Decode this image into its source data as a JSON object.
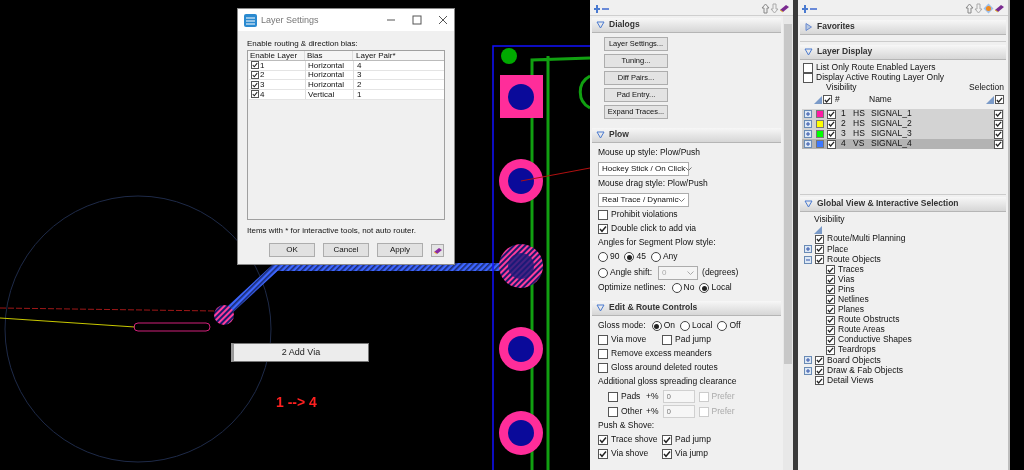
{
  "canvas": {
    "tooltip": "2 Add Via",
    "annotation": "1 --> 4"
  },
  "layer_settings_dialog": {
    "title": "Layer Settings",
    "prompt": "Enable routing & direction bias:",
    "columns": [
      "Enable Layer",
      "Bias",
      "Layer Pair*"
    ],
    "rows": [
      {
        "enabled": true,
        "layer": "1",
        "bias": "Horizontal",
        "pair": "4"
      },
      {
        "enabled": true,
        "layer": "2",
        "bias": "Horizontal",
        "pair": "3"
      },
      {
        "enabled": true,
        "layer": "3",
        "bias": "Horizontal",
        "pair": "2"
      },
      {
        "enabled": true,
        "layer": "4",
        "bias": "Vertical",
        "pair": "1"
      }
    ],
    "note": "Items with * for interactive tools, not auto router.",
    "buttons": [
      "OK",
      "Cancel",
      "Apply"
    ]
  },
  "options_panel": {
    "sections": [
      {
        "title": "Dialogs",
        "expanded": true,
        "items": [
          {
            "kind": "button",
            "label": "Layer Settings..."
          },
          {
            "kind": "button",
            "label": "Tuning..."
          },
          {
            "kind": "button",
            "label": "Diff Pairs..."
          },
          {
            "kind": "button",
            "label": "Pad Entry..."
          },
          {
            "kind": "button",
            "label": "Expand Traces..."
          }
        ]
      },
      {
        "title": "Plow",
        "expanded": true,
        "items": [
          {
            "kind": "label",
            "text": "Mouse up style: Plow/Push"
          },
          {
            "kind": "select",
            "value": "Hockey Stick / On Click"
          },
          {
            "kind": "label",
            "text": "Mouse drag style: Plow/Push"
          },
          {
            "kind": "select",
            "value": "Real Trace / Dynamic"
          },
          {
            "kind": "checks",
            "items": [
              {
                "label": "Prohibit violations",
                "checked": false
              }
            ]
          },
          {
            "kind": "checks",
            "items": [
              {
                "label": "Double click to add via",
                "checked": true
              }
            ]
          },
          {
            "kind": "label",
            "text": "Angles for Segment Plow style:"
          },
          {
            "kind": "radios",
            "options": [
              {
                "label": "90",
                "selected": false
              },
              {
                "label": "45",
                "selected": true
              },
              {
                "label": "Any",
                "selected": false
              }
            ]
          },
          {
            "kind": "angle_shift",
            "label": "Angle shift:",
            "selected": false,
            "value": "0",
            "disabled": true,
            "suffix": "(degrees)"
          },
          {
            "kind": "radios",
            "label": "Optimize netlines:",
            "options": [
              {
                "label": "No",
                "selected": false
              },
              {
                "label": "Local",
                "selected": true
              }
            ]
          }
        ]
      },
      {
        "title": "Edit & Route Controls",
        "expanded": true,
        "items": [
          {
            "kind": "radios",
            "label": "Gloss mode:",
            "options": [
              {
                "label": "On",
                "selected": true
              },
              {
                "label": "Local",
                "selected": false
              },
              {
                "label": "Off",
                "selected": false
              }
            ]
          },
          {
            "kind": "checks",
            "items": [
              {
                "label": "Via move",
                "checked": false
              },
              {
                "label": "Pad jump",
                "checked": false
              }
            ]
          },
          {
            "kind": "checks",
            "items": [
              {
                "label": "Remove excess meanders",
                "checked": false
              }
            ]
          },
          {
            "kind": "checks",
            "items": [
              {
                "label": "Gloss around deleted routes",
                "checked": false
              }
            ]
          },
          {
            "kind": "label",
            "text": "Additional gloss spreading clearance"
          },
          {
            "kind": "clearance",
            "label": "Pads",
            "checked": false,
            "unit": "+%",
            "value": "0",
            "disabled": true,
            "prefer": "Prefer",
            "prefer_checked": false
          },
          {
            "kind": "clearance",
            "label": "Other",
            "checked": false,
            "unit": "+%",
            "value": "0",
            "disabled": true,
            "prefer": "Prefer",
            "prefer_checked": false
          },
          {
            "kind": "label",
            "text": "Push & Shove:"
          },
          {
            "kind": "checks",
            "items": [
              {
                "label": "Trace shove",
                "checked": true
              },
              {
                "label": "Pad jump",
                "checked": true
              }
            ]
          },
          {
            "kind": "checks",
            "items": [
              {
                "label": "Via shove",
                "checked": true
              },
              {
                "label": "Via jump",
                "checked": true
              }
            ]
          }
        ]
      }
    ]
  },
  "display_panel": {
    "favorites": {
      "title": "Favorites",
      "expanded": false
    },
    "layer_display": {
      "title": "Layer Display",
      "expanded": true,
      "options": [
        {
          "label": "List Only Route Enabled Layers",
          "checked": false
        },
        {
          "label": "Display Active Routing Layer Only",
          "checked": false
        }
      ],
      "visibility_label": "Visibility",
      "selection_label": "Selection",
      "all_visible": true,
      "all_selectable": true,
      "columns": [
        "#",
        "Name"
      ],
      "layers": [
        {
          "number": "1",
          "type": "HS",
          "name": "SIGNAL_1",
          "color": "#ff1aa6",
          "visible": true,
          "selectable": true,
          "selected": false
        },
        {
          "number": "2",
          "type": "HS",
          "name": "SIGNAL_2",
          "color": "#ffff00",
          "visible": true,
          "selectable": true,
          "selected": false
        },
        {
          "number": "3",
          "type": "HS",
          "name": "SIGNAL_3",
          "color": "#00ff00",
          "visible": true,
          "selectable": true,
          "selected": false
        },
        {
          "number": "4",
          "type": "VS",
          "name": "SIGNAL_4",
          "color": "#3c78ff",
          "visible": true,
          "selectable": true,
          "selected": true
        }
      ]
    },
    "global_view": {
      "title": "Global View & Interactive Selection",
      "expanded": true,
      "visibility_label": "Visibility",
      "items": [
        {
          "label": "Route/Multi Planning",
          "checked": true
        },
        {
          "label": "Place",
          "checked": true,
          "expanded": false
        },
        {
          "label": "Route Objects",
          "checked": true,
          "expanded": true,
          "children": [
            {
              "label": "Traces",
              "checked": true
            },
            {
              "label": "Vias",
              "checked": true
            },
            {
              "label": "Pins",
              "checked": true
            },
            {
              "label": "Netlines",
              "checked": true
            },
            {
              "label": "Planes",
              "checked": true
            },
            {
              "label": "Route Obstructs",
              "checked": true
            },
            {
              "label": "Route Areas",
              "checked": true
            },
            {
              "label": "Conductive Shapes",
              "checked": true
            },
            {
              "label": "Teardrops",
              "checked": true
            }
          ]
        },
        {
          "label": "Board Objects",
          "checked": true,
          "expanded": false
        },
        {
          "label": "Draw & Fab Objects",
          "checked": true,
          "expanded": false
        },
        {
          "label": "Detail Views",
          "checked": true
        }
      ]
    }
  }
}
